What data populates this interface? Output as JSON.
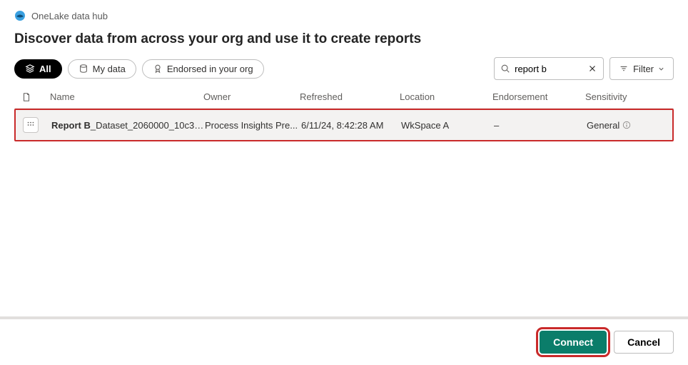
{
  "header": {
    "hub_title": "OneLake data hub",
    "page_title": "Discover data from across your org and use it to create reports"
  },
  "filters": {
    "all": "All",
    "my_data": "My data",
    "endorsed": "Endorsed in your org",
    "filter_label": "Filter"
  },
  "search": {
    "value": "report b"
  },
  "table": {
    "headers": {
      "name": "Name",
      "owner": "Owner",
      "refreshed": "Refreshed",
      "location": "Location",
      "endorsement": "Endorsement",
      "sensitivity": "Sensitivity"
    },
    "rows": [
      {
        "name_bold": "Report B",
        "name_rest": "_Dataset_2060000_10c38...",
        "owner": "Process Insights Pre...",
        "refreshed": "6/11/24, 8:42:28 AM",
        "location": "WkSpace A",
        "endorsement": "–",
        "sensitivity": "General"
      }
    ]
  },
  "footer": {
    "connect": "Connect",
    "cancel": "Cancel"
  }
}
